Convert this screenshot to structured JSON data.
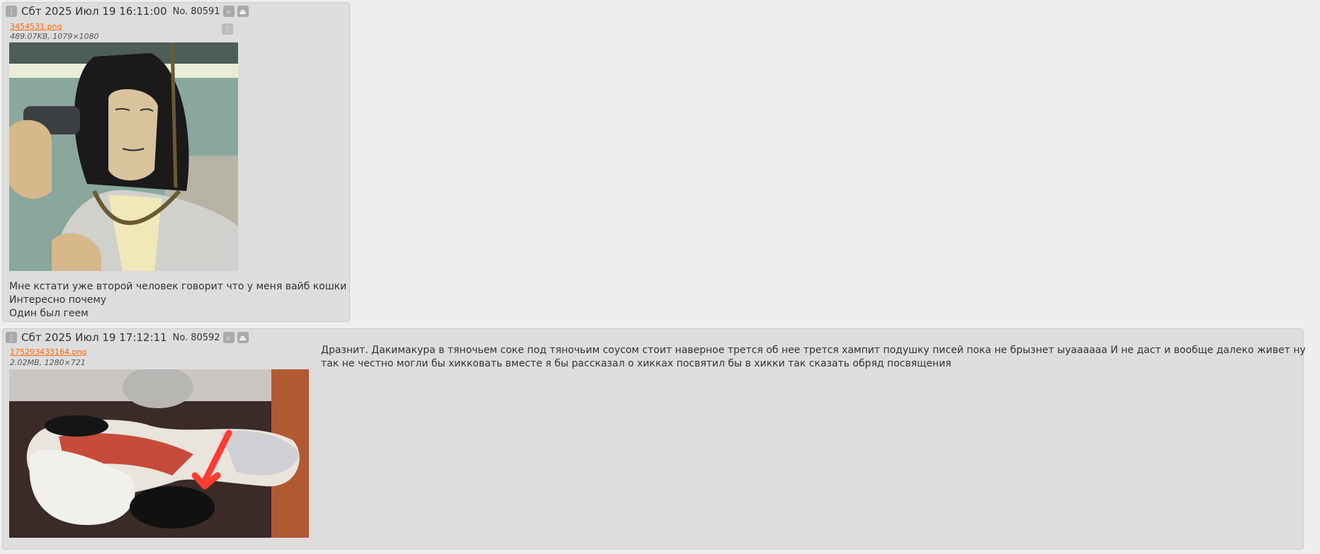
{
  "colors": {
    "page_bg": "#eeeeee",
    "post_bg": "#dddddd",
    "file_link": "#ff6600",
    "button_bg": "#a9a9a9"
  },
  "icons": {
    "menu": "vertical-dots-icon",
    "search": "magnifier-icon",
    "expand": "eject-icon"
  },
  "posts": [
    {
      "date": "Сбт 2025 Июл 19 16:11:00",
      "no_label": "No.",
      "no": "80591",
      "file": {
        "name": "3454531.png",
        "meta": "489.07KB, 1079×1080"
      },
      "lines": [
        "Мне кстати уже второй человек говорит что у меня вайб кошки",
        "Интересно почему",
        "Один был геем"
      ]
    },
    {
      "date": "Сбт 2025 Июл 19 17:12:11",
      "no_label": "No.",
      "no": "80592",
      "file": {
        "name": "175293433164.png",
        "meta": "2.02MB, 1280×721"
      },
      "lines": [
        "Дразнит. Дакимакура в тяночьем соке под тяночьим соусом стоит наверное трется об нее трется хампит подушку писей пока не брызнет ыуаааааа И не даст и вообще далеко живет ну",
        "так не честно могли бы хикковать вместе я бы рассказал о хикках посвятил бы в хикки так сказать обряд посвящения"
      ]
    }
  ]
}
